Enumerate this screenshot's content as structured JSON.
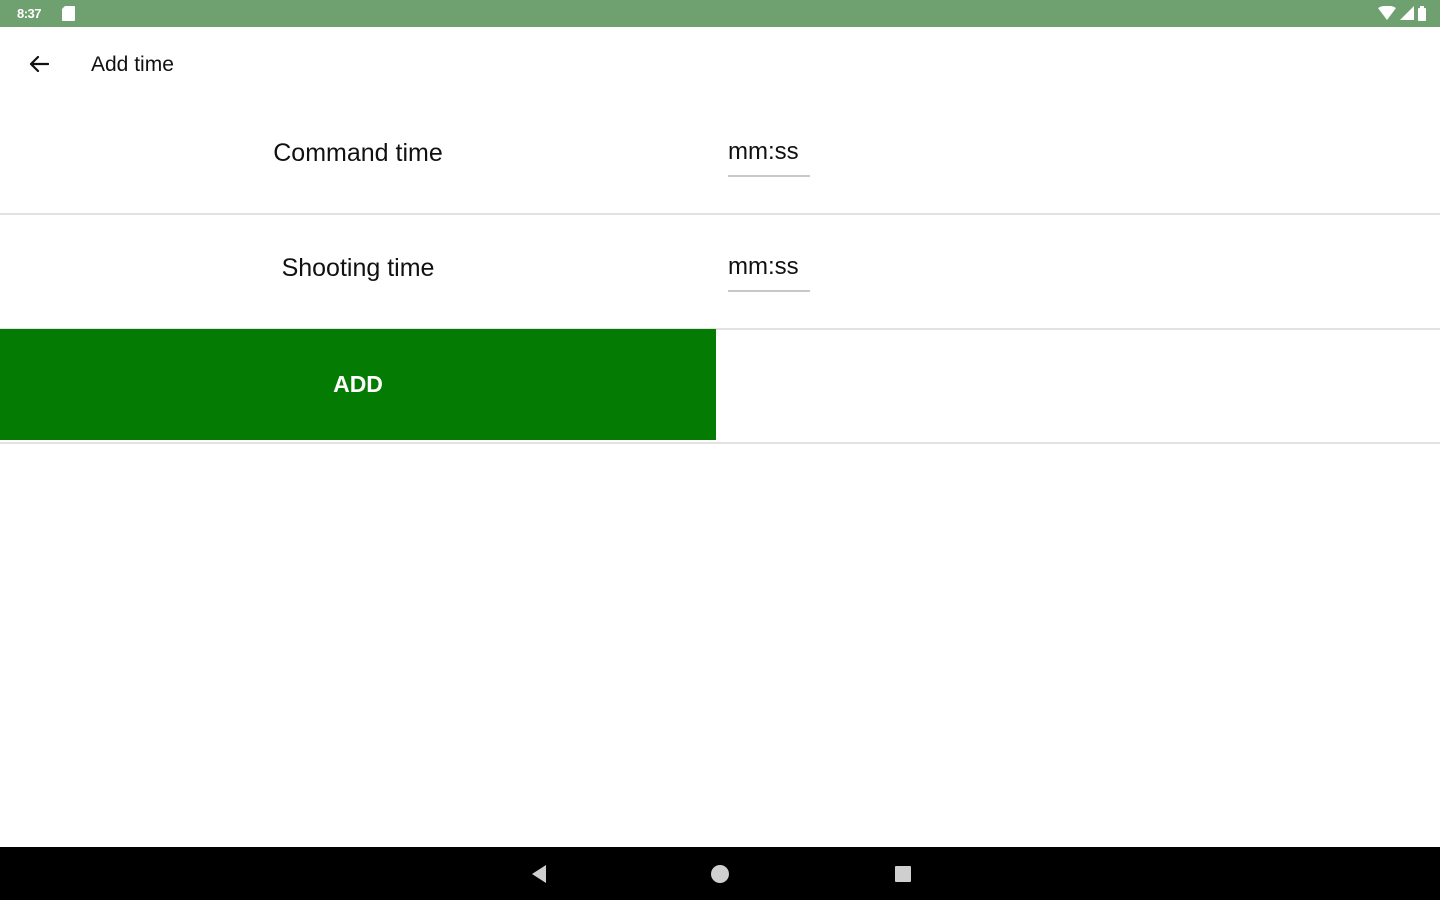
{
  "status_bar": {
    "time": "8:37",
    "icons": [
      "sd-card-icon",
      "wifi-icon",
      "cell-signal-icon",
      "battery-icon"
    ]
  },
  "app_bar": {
    "title": "Add time",
    "back_icon": "arrow-back-icon"
  },
  "form": {
    "command_time": {
      "label": "Command time",
      "placeholder": "mm:ss",
      "value": ""
    },
    "shooting_time": {
      "label": "Shooting time",
      "placeholder": "mm:ss",
      "value": ""
    },
    "add_label": "ADD"
  },
  "nav_bar": {
    "icons": [
      "nav-back-icon",
      "nav-home-icon",
      "nav-recents-icon"
    ]
  },
  "colors": {
    "status_bar": "#6fa06f",
    "add_button": "#047c04",
    "nav_bar": "#000000",
    "divider": "#e2e2e2"
  }
}
